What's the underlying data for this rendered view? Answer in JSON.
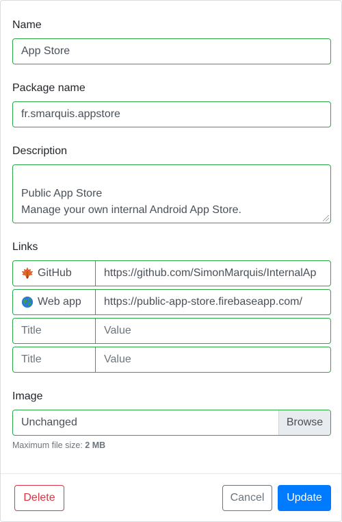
{
  "form": {
    "name_label": "Name",
    "name_value": "App Store",
    "package_label": "Package name",
    "package_value": "fr.smarquis.appstore",
    "description_label": "Description",
    "description_value": "Public App Store\nManage your own internal Android App Store.",
    "links_label": "Links",
    "links": [
      {
        "icon": "maple-leaf-emoji-icon",
        "title": "GitHub",
        "value": "https://github.com/SimonMarquis/InternalAp"
      },
      {
        "icon": "globe-emoji-icon",
        "title": "Web app",
        "value": "https://public-app-store.firebaseapp.com/"
      },
      {
        "title_placeholder": "Title",
        "value_placeholder": "Value"
      },
      {
        "title_placeholder": "Title",
        "value_placeholder": "Value"
      }
    ],
    "image_label": "Image",
    "image_value": "Unchanged",
    "browse_label": "Browse",
    "help_prefix": "Maximum file size: ",
    "help_size": "2 MB"
  },
  "footer": {
    "delete_label": "Delete",
    "cancel_label": "Cancel",
    "update_label": "Update"
  },
  "colors": {
    "valid_border": "#28a745",
    "danger": "#dc3545",
    "secondary": "#6c757d",
    "primary": "#007bff"
  }
}
